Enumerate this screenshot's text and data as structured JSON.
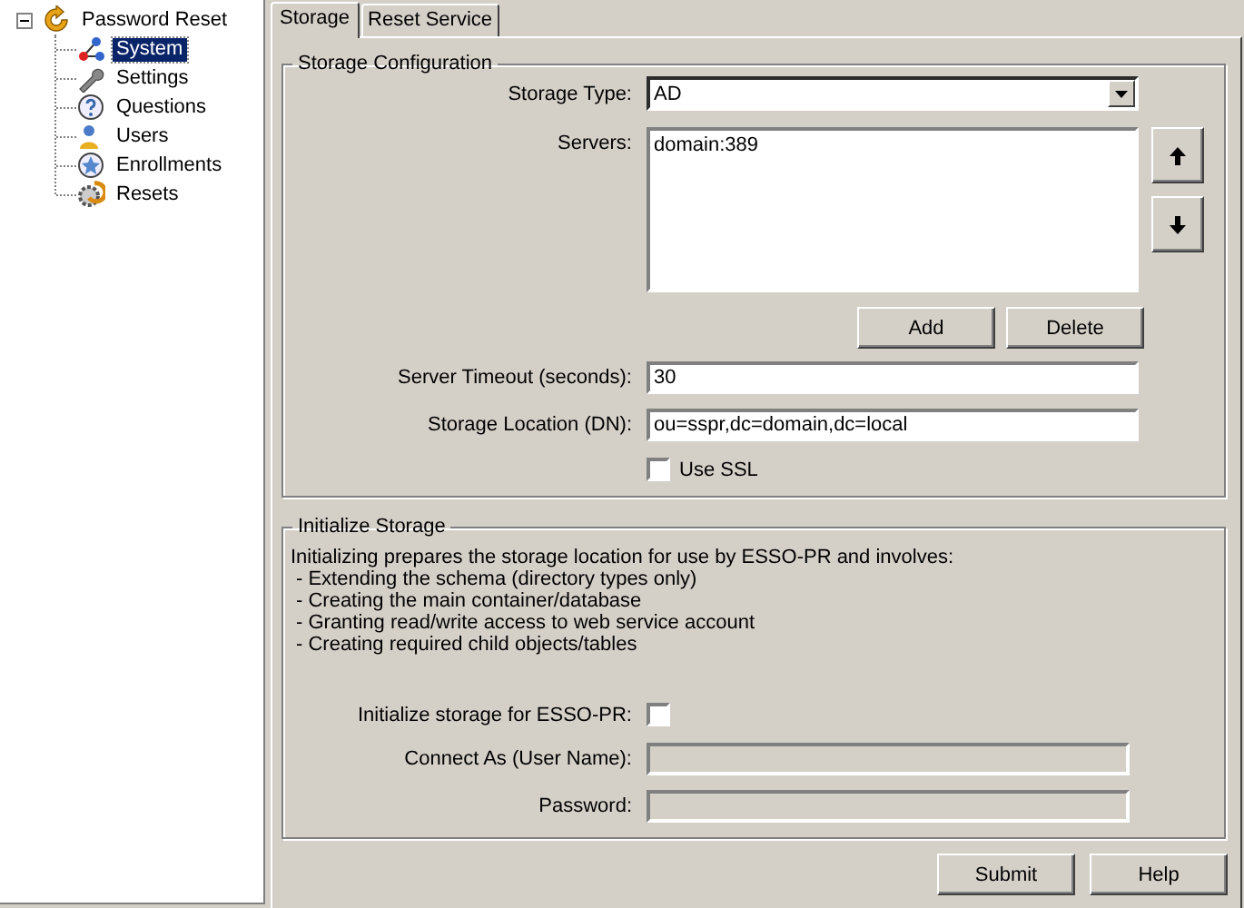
{
  "tree": {
    "label": "Password Reset",
    "expanded": true,
    "children": [
      {
        "label": "System",
        "selected": true
      },
      {
        "label": "Settings",
        "selected": false
      },
      {
        "label": "Questions",
        "selected": false
      },
      {
        "label": "Users",
        "selected": false
      },
      {
        "label": "Enrollments",
        "selected": false
      },
      {
        "label": "Resets",
        "selected": false
      }
    ]
  },
  "tabs": [
    {
      "label": "Storage",
      "selected": true
    },
    {
      "label": "Reset Service",
      "selected": false
    }
  ],
  "storage_configuration": {
    "title": "Storage Configuration",
    "storage_type": {
      "label": "Storage Type:",
      "value": "AD"
    },
    "servers": {
      "label": "Servers:",
      "items": [
        "domain:389"
      ]
    },
    "server_buttons": [
      "Add",
      "Delete"
    ],
    "server_timeout": {
      "label": "Server Timeout (seconds):",
      "value": "30"
    },
    "storage_location": {
      "label": "Storage Location (DN):",
      "value": "ou=sspr,dc=domain,dc=local"
    },
    "use_ssl": {
      "label": "Use SSL",
      "checked": false
    }
  },
  "initialize_storage": {
    "title": "Initialize Storage",
    "intro": "Initializing prepares the storage location for use by ESSO-PR and involves:",
    "steps": [
      "- Extending the schema (directory types only)",
      "- Creating the main container/database",
      "- Granting read/write access to web service account",
      "- Creating required child objects/tables"
    ],
    "initialize": {
      "label": "Initialize storage for ESSO-PR:",
      "checked": false
    },
    "connect_as": {
      "label": "Connect As (User Name):",
      "disabled": true
    },
    "password": {
      "label": "Password:",
      "disabled": true
    }
  },
  "buttons": [
    "Submit",
    "Help"
  ]
}
